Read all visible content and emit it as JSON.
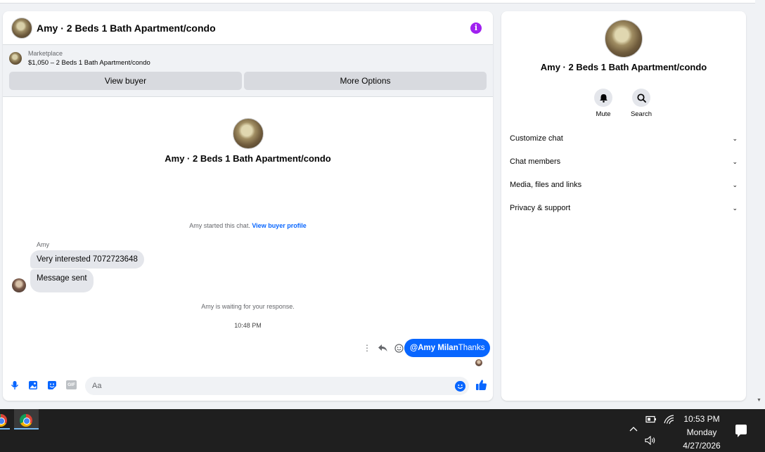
{
  "chat": {
    "title": "Amy · 2 Beds 1 Bath Apartment/condo",
    "marketplace_label": "Marketplace",
    "listing": "$1,050 – 2 Beds 1 Bath Apartment/condo",
    "view_buyer": "View buyer",
    "more_options": "More Options",
    "profile_name": "Amy · 2 Beds 1 Bath Apartment/condo",
    "started_text": "Amy started this chat.",
    "view_buyer_profile": "View buyer profile",
    "sender": "Amy",
    "messages_in": [
      "Very interested 7072723648",
      "Message sent"
    ],
    "waiting_text": "Amy is waiting for your response.",
    "time": "10:48 PM",
    "out_mention": "@Amy Milan",
    "out_text": "Thanks",
    "input_placeholder": "Aa",
    "gif_label": "GIF"
  },
  "side": {
    "name": "Amy · 2 Beds 1 Bath Apartment/condo",
    "mute": "Mute",
    "search": "Search",
    "sections": [
      "Customize chat",
      "Chat members",
      "Media, files and links",
      "Privacy & support"
    ]
  },
  "taskbar": {
    "time": "10:53 PM",
    "day": "Monday",
    "date": "4/27/2026"
  },
  "colors": {
    "accent": "#0866ff",
    "info": "#a020f0"
  }
}
